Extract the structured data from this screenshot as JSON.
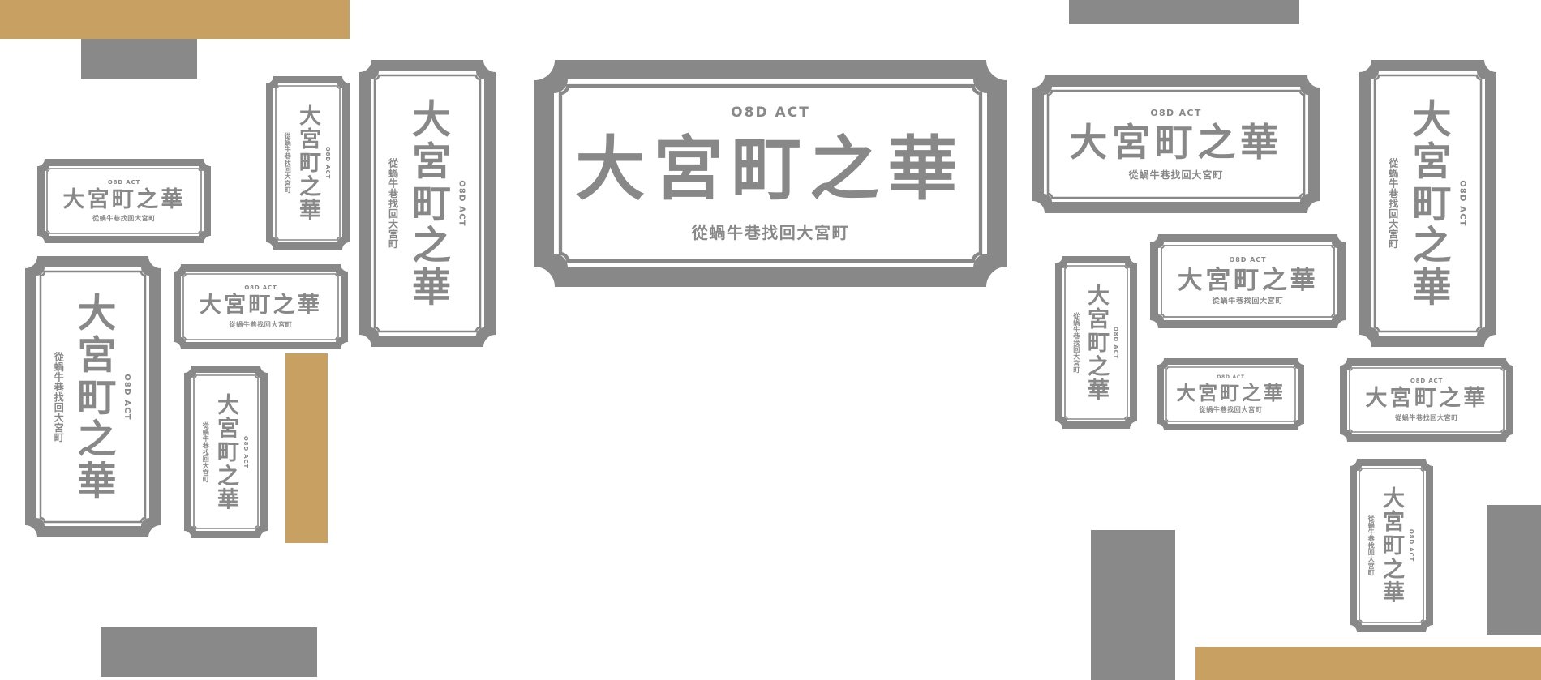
{
  "colors": {
    "sign_gray": "#888888",
    "gold": "#c8a062",
    "block_gray": "#898989",
    "background": "#ffffff"
  },
  "sign": {
    "brand": "O8D ACT",
    "title": "大宮町之華",
    "subtitle": "從蝸牛巷找回大宮町"
  }
}
